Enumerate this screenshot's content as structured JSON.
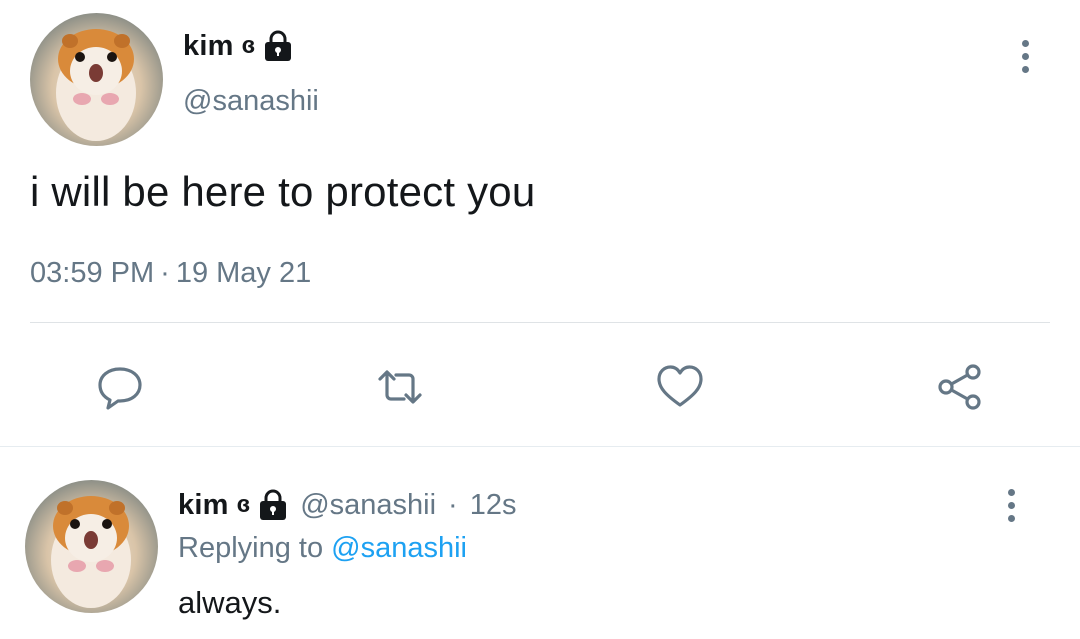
{
  "main_tweet": {
    "display_name": "kim",
    "name_emoji": "ɞ",
    "handle": "@sanashii",
    "text": "i will be here to protect you",
    "time": "03:59 PM",
    "separator": "·",
    "date": "19 May 21",
    "avatar_icon": "hamster-avatar",
    "badge_icon": "lock-icon"
  },
  "actions": [
    {
      "name": "reply",
      "icon": "speech-bubble-icon"
    },
    {
      "name": "retweet",
      "icon": "retweet-arrows-icon"
    },
    {
      "name": "like",
      "icon": "heart-icon"
    },
    {
      "name": "share",
      "icon": "share-nodes-icon"
    }
  ],
  "reply": {
    "display_name": "kim",
    "name_emoji": "ɞ",
    "handle": "@sanashii",
    "separator": "·",
    "age": "12s",
    "replying_to_label": "Replying to",
    "replying_to_handle": "@sanashii",
    "text": "always."
  },
  "colors": {
    "text_primary": "#14171a",
    "text_secondary": "#657786",
    "link": "#1da1f2",
    "divider": "#e6ecf0"
  }
}
